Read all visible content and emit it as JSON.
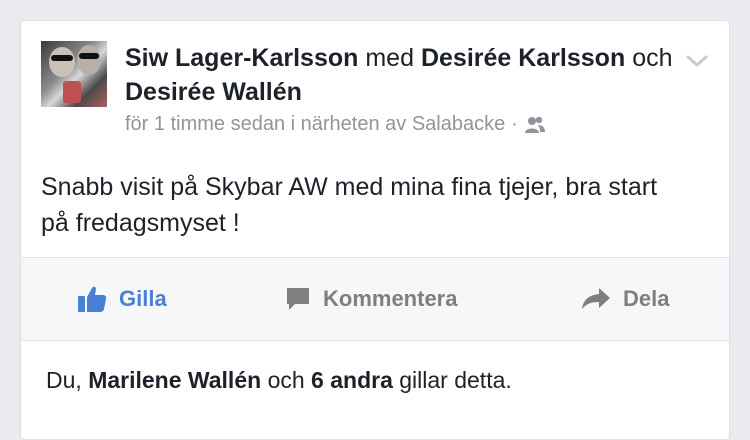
{
  "post": {
    "author": "Siw Lager-Karlsson",
    "with_word": "med",
    "tagged_1": "Desirée Karlsson",
    "and_word": "och",
    "tagged_2": "Desirée Wallén",
    "meta_text": "för 1 timme sedan i närheten av Salabacke",
    "meta_dot": "·",
    "privacy_icon": "friends-icon",
    "menu_icon": "chevron-down-icon",
    "message": "Snabb visit på Skybar AW med mina fina tjejer, bra start på fredagsmyset !"
  },
  "actions": {
    "like_label": "Gilla",
    "comment_label": "Kommentera",
    "share_label": "Dela"
  },
  "likes": {
    "prefix": "Du,",
    "name": "Marilene Wallén",
    "and_word": "och",
    "others": "6 andra",
    "suffix": "gillar detta."
  },
  "colors": {
    "like_blue": "#4a7fd8",
    "muted_gray": "#90949c",
    "text": "#1d2129",
    "action_gray": "#7f7f7f"
  }
}
